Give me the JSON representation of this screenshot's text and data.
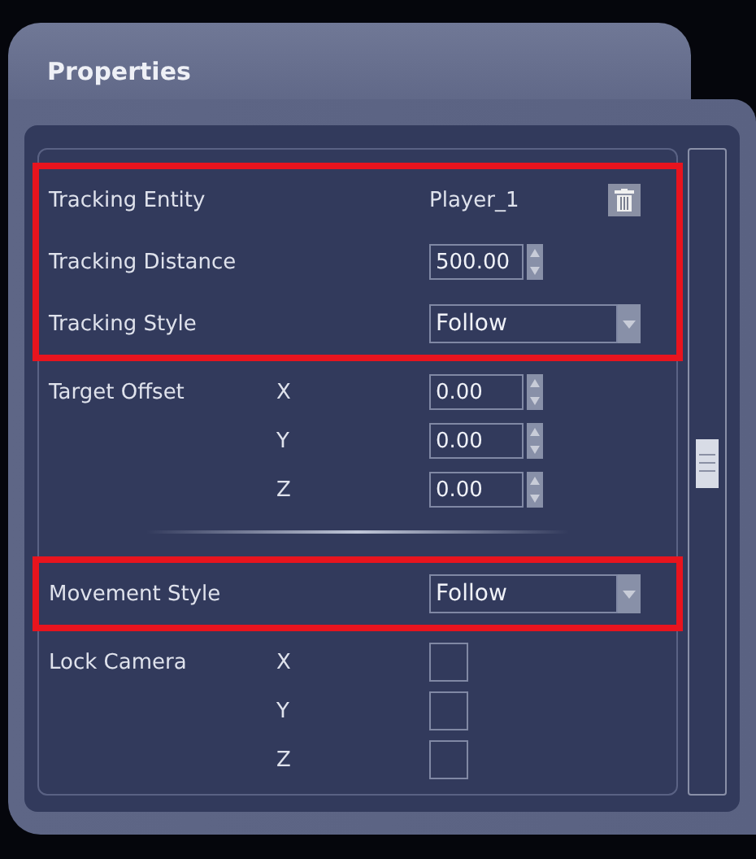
{
  "panel": {
    "title": "Properties"
  },
  "sections": [
    {
      "highlighted": true,
      "rows": [
        {
          "kind": "text",
          "label": "Tracking Entity",
          "value": "Player_1"
        },
        {
          "kind": "spinner",
          "label": "Tracking Distance",
          "value": "500.00"
        },
        {
          "kind": "dropdown",
          "label": "Tracking Style",
          "value": "Follow"
        }
      ]
    },
    {
      "highlighted": false,
      "rows": [
        {
          "kind": "vector-spinner",
          "label": "Target Offset",
          "axes": [
            {
              "axis": "X",
              "value": "0.00"
            },
            {
              "axis": "Y",
              "value": "0.00"
            },
            {
              "axis": "Z",
              "value": "0.00"
            }
          ]
        },
        {
          "kind": "divider"
        }
      ]
    },
    {
      "highlighted": true,
      "rows": [
        {
          "kind": "dropdown",
          "label": "Movement Style",
          "value": "Follow"
        }
      ]
    },
    {
      "highlighted": false,
      "rows": [
        {
          "kind": "vector-check",
          "label": "Lock Camera",
          "axes": [
            {
              "axis": "X",
              "checked": false
            },
            {
              "axis": "Y",
              "checked": false
            },
            {
              "axis": "Z",
              "checked": false
            }
          ]
        }
      ]
    }
  ]
}
